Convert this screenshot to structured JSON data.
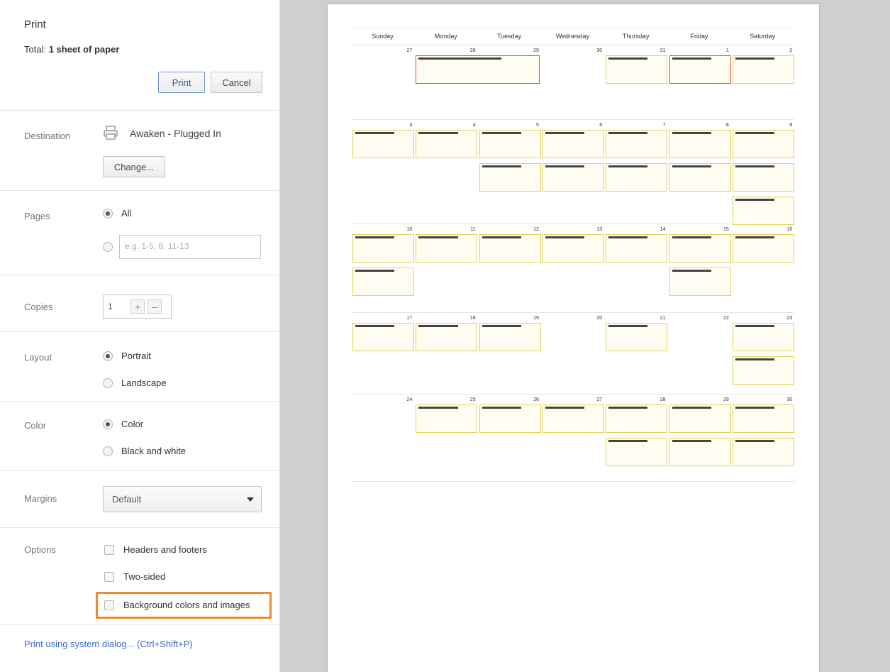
{
  "dialog": {
    "title": "Print",
    "total_prefix": "Total: ",
    "total_value": "1 sheet of paper",
    "print_label": "Print",
    "cancel_label": "Cancel"
  },
  "destination": {
    "label": "Destination",
    "printer_name": "Awaken - Plugged In",
    "change_label": "Change..."
  },
  "pages": {
    "label": "Pages",
    "all_label": "All",
    "all_selected": true,
    "custom_placeholder": "e.g. 1-5, 8, 11-13"
  },
  "copies": {
    "label": "Copies",
    "value": "1",
    "increment_label": "+",
    "decrement_label": "–"
  },
  "layout": {
    "label": "Layout",
    "options": [
      "Portrait",
      "Landscape"
    ],
    "selected": "Portrait"
  },
  "color": {
    "label": "Color",
    "options": [
      "Color",
      "Black and white"
    ],
    "selected": "Color"
  },
  "margins": {
    "label": "Margins",
    "value": "Default"
  },
  "options": {
    "label": "Options",
    "items": [
      "Headers and footers",
      "Two-sided",
      "Background colors and images"
    ],
    "highlight_color": "#f08a2c"
  },
  "system_dialog_link": "Print using system dialog... (Ctrl+Shift+P)",
  "preview": {
    "weekdays": [
      "Sunday",
      "Monday",
      "Tuesday",
      "Wednesday",
      "Thursday",
      "Friday",
      "Saturday"
    ],
    "weeks": [
      [
        "27",
        "28",
        "29",
        "30",
        "31",
        "1",
        "2"
      ],
      [
        "3",
        "4",
        "5",
        "6",
        "7",
        "8",
        "9"
      ],
      [
        "10",
        "11",
        "12",
        "13",
        "14",
        "15",
        "16"
      ],
      [
        "17",
        "18",
        "19",
        "20",
        "21",
        "22",
        "23"
      ],
      [
        "24",
        "25",
        "26",
        "27",
        "28",
        "29",
        "30"
      ]
    ]
  }
}
